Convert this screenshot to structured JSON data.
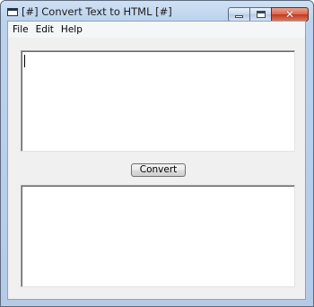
{
  "window": {
    "title": "[#] Convert Text to HTML [#]",
    "caption_buttons": {
      "minimize_icon": "minimize-icon",
      "maximize_icon": "maximize-icon",
      "close_icon": "close-icon",
      "close_glyph": "✕"
    }
  },
  "menubar": {
    "items": [
      {
        "label": "File"
      },
      {
        "label": "Edit"
      },
      {
        "label": "Help"
      }
    ]
  },
  "input_text": {
    "value": "",
    "has_focus_caret": true
  },
  "convert_button": {
    "label": "Convert"
  },
  "output_text": {
    "value": ""
  },
  "colors": {
    "title_bar": "#bcd3ee",
    "client_background": "#f0f0f0",
    "close_button": "#c6381c"
  }
}
